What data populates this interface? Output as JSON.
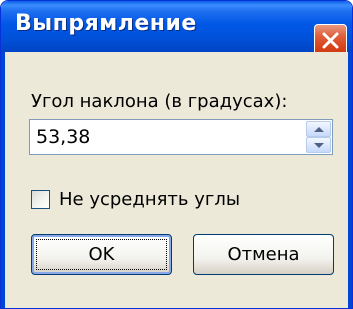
{
  "dialog": {
    "title": "Выпрямление",
    "close_icon": "close-icon"
  },
  "angle": {
    "label": "Угол наклона (в градусах):",
    "value": "53,38",
    "up_icon": "spin-up-icon",
    "down_icon": "spin-down-icon"
  },
  "no_average": {
    "label": "Не усреднять углы",
    "checked": false
  },
  "buttons": {
    "ok": "OK",
    "cancel": "Отмена"
  },
  "colors": {
    "titlebar": "#0058e6",
    "face": "#ece9d8",
    "close": "#d8431c"
  }
}
